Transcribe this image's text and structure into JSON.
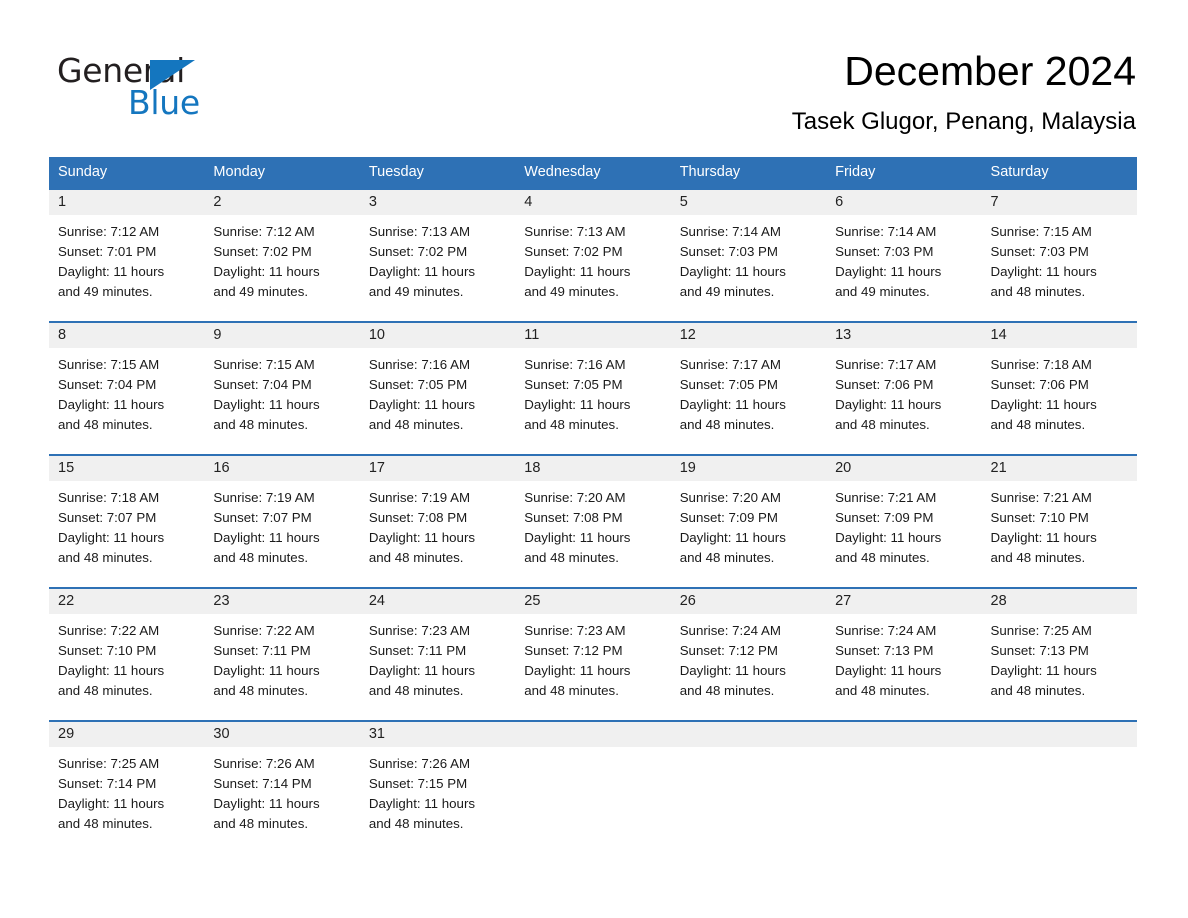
{
  "brand": {
    "name_top": "General",
    "name_bottom": "Blue",
    "triangle_color": "#1476bf",
    "text_color": "#231f20"
  },
  "header": {
    "title": "December 2024",
    "subtitle": "Tasek Glugor, Penang, Malaysia"
  },
  "theme": {
    "header_blue": "#2e71b5",
    "daynum_band": "#f0f0f0",
    "page_background": "#ffffff",
    "text": "#1a1a1a"
  },
  "weekdays": [
    "Sunday",
    "Monday",
    "Tuesday",
    "Wednesday",
    "Thursday",
    "Friday",
    "Saturday"
  ],
  "labels": {
    "sunrise_prefix": "Sunrise:",
    "sunset_prefix": "Sunset:",
    "daylight_prefix": "Daylight:"
  },
  "weeks": [
    [
      {
        "day": "1",
        "sunrise": "Sunrise: 7:12 AM",
        "sunset": "Sunset: 7:01 PM",
        "daylight1": "Daylight: 11 hours",
        "daylight2": "and 49 minutes."
      },
      {
        "day": "2",
        "sunrise": "Sunrise: 7:12 AM",
        "sunset": "Sunset: 7:02 PM",
        "daylight1": "Daylight: 11 hours",
        "daylight2": "and 49 minutes."
      },
      {
        "day": "3",
        "sunrise": "Sunrise: 7:13 AM",
        "sunset": "Sunset: 7:02 PM",
        "daylight1": "Daylight: 11 hours",
        "daylight2": "and 49 minutes."
      },
      {
        "day": "4",
        "sunrise": "Sunrise: 7:13 AM",
        "sunset": "Sunset: 7:02 PM",
        "daylight1": "Daylight: 11 hours",
        "daylight2": "and 49 minutes."
      },
      {
        "day": "5",
        "sunrise": "Sunrise: 7:14 AM",
        "sunset": "Sunset: 7:03 PM",
        "daylight1": "Daylight: 11 hours",
        "daylight2": "and 49 minutes."
      },
      {
        "day": "6",
        "sunrise": "Sunrise: 7:14 AM",
        "sunset": "Sunset: 7:03 PM",
        "daylight1": "Daylight: 11 hours",
        "daylight2": "and 49 minutes."
      },
      {
        "day": "7",
        "sunrise": "Sunrise: 7:15 AM",
        "sunset": "Sunset: 7:03 PM",
        "daylight1": "Daylight: 11 hours",
        "daylight2": "and 48 minutes."
      }
    ],
    [
      {
        "day": "8",
        "sunrise": "Sunrise: 7:15 AM",
        "sunset": "Sunset: 7:04 PM",
        "daylight1": "Daylight: 11 hours",
        "daylight2": "and 48 minutes."
      },
      {
        "day": "9",
        "sunrise": "Sunrise: 7:15 AM",
        "sunset": "Sunset: 7:04 PM",
        "daylight1": "Daylight: 11 hours",
        "daylight2": "and 48 minutes."
      },
      {
        "day": "10",
        "sunrise": "Sunrise: 7:16 AM",
        "sunset": "Sunset: 7:05 PM",
        "daylight1": "Daylight: 11 hours",
        "daylight2": "and 48 minutes."
      },
      {
        "day": "11",
        "sunrise": "Sunrise: 7:16 AM",
        "sunset": "Sunset: 7:05 PM",
        "daylight1": "Daylight: 11 hours",
        "daylight2": "and 48 minutes."
      },
      {
        "day": "12",
        "sunrise": "Sunrise: 7:17 AM",
        "sunset": "Sunset: 7:05 PM",
        "daylight1": "Daylight: 11 hours",
        "daylight2": "and 48 minutes."
      },
      {
        "day": "13",
        "sunrise": "Sunrise: 7:17 AM",
        "sunset": "Sunset: 7:06 PM",
        "daylight1": "Daylight: 11 hours",
        "daylight2": "and 48 minutes."
      },
      {
        "day": "14",
        "sunrise": "Sunrise: 7:18 AM",
        "sunset": "Sunset: 7:06 PM",
        "daylight1": "Daylight: 11 hours",
        "daylight2": "and 48 minutes."
      }
    ],
    [
      {
        "day": "15",
        "sunrise": "Sunrise: 7:18 AM",
        "sunset": "Sunset: 7:07 PM",
        "daylight1": "Daylight: 11 hours",
        "daylight2": "and 48 minutes."
      },
      {
        "day": "16",
        "sunrise": "Sunrise: 7:19 AM",
        "sunset": "Sunset: 7:07 PM",
        "daylight1": "Daylight: 11 hours",
        "daylight2": "and 48 minutes."
      },
      {
        "day": "17",
        "sunrise": "Sunrise: 7:19 AM",
        "sunset": "Sunset: 7:08 PM",
        "daylight1": "Daylight: 11 hours",
        "daylight2": "and 48 minutes."
      },
      {
        "day": "18",
        "sunrise": "Sunrise: 7:20 AM",
        "sunset": "Sunset: 7:08 PM",
        "daylight1": "Daylight: 11 hours",
        "daylight2": "and 48 minutes."
      },
      {
        "day": "19",
        "sunrise": "Sunrise: 7:20 AM",
        "sunset": "Sunset: 7:09 PM",
        "daylight1": "Daylight: 11 hours",
        "daylight2": "and 48 minutes."
      },
      {
        "day": "20",
        "sunrise": "Sunrise: 7:21 AM",
        "sunset": "Sunset: 7:09 PM",
        "daylight1": "Daylight: 11 hours",
        "daylight2": "and 48 minutes."
      },
      {
        "day": "21",
        "sunrise": "Sunrise: 7:21 AM",
        "sunset": "Sunset: 7:10 PM",
        "daylight1": "Daylight: 11 hours",
        "daylight2": "and 48 minutes."
      }
    ],
    [
      {
        "day": "22",
        "sunrise": "Sunrise: 7:22 AM",
        "sunset": "Sunset: 7:10 PM",
        "daylight1": "Daylight: 11 hours",
        "daylight2": "and 48 minutes."
      },
      {
        "day": "23",
        "sunrise": "Sunrise: 7:22 AM",
        "sunset": "Sunset: 7:11 PM",
        "daylight1": "Daylight: 11 hours",
        "daylight2": "and 48 minutes."
      },
      {
        "day": "24",
        "sunrise": "Sunrise: 7:23 AM",
        "sunset": "Sunset: 7:11 PM",
        "daylight1": "Daylight: 11 hours",
        "daylight2": "and 48 minutes."
      },
      {
        "day": "25",
        "sunrise": "Sunrise: 7:23 AM",
        "sunset": "Sunset: 7:12 PM",
        "daylight1": "Daylight: 11 hours",
        "daylight2": "and 48 minutes."
      },
      {
        "day": "26",
        "sunrise": "Sunrise: 7:24 AM",
        "sunset": "Sunset: 7:12 PM",
        "daylight1": "Daylight: 11 hours",
        "daylight2": "and 48 minutes."
      },
      {
        "day": "27",
        "sunrise": "Sunrise: 7:24 AM",
        "sunset": "Sunset: 7:13 PM",
        "daylight1": "Daylight: 11 hours",
        "daylight2": "and 48 minutes."
      },
      {
        "day": "28",
        "sunrise": "Sunrise: 7:25 AM",
        "sunset": "Sunset: 7:13 PM",
        "daylight1": "Daylight: 11 hours",
        "daylight2": "and 48 minutes."
      }
    ],
    [
      {
        "day": "29",
        "sunrise": "Sunrise: 7:25 AM",
        "sunset": "Sunset: 7:14 PM",
        "daylight1": "Daylight: 11 hours",
        "daylight2": "and 48 minutes."
      },
      {
        "day": "30",
        "sunrise": "Sunrise: 7:26 AM",
        "sunset": "Sunset: 7:14 PM",
        "daylight1": "Daylight: 11 hours",
        "daylight2": "and 48 minutes."
      },
      {
        "day": "31",
        "sunrise": "Sunrise: 7:26 AM",
        "sunset": "Sunset: 7:15 PM",
        "daylight1": "Daylight: 11 hours",
        "daylight2": "and 48 minutes."
      },
      {
        "day": "",
        "sunrise": "",
        "sunset": "",
        "daylight1": "",
        "daylight2": ""
      },
      {
        "day": "",
        "sunrise": "",
        "sunset": "",
        "daylight1": "",
        "daylight2": ""
      },
      {
        "day": "",
        "sunrise": "",
        "sunset": "",
        "daylight1": "",
        "daylight2": ""
      },
      {
        "day": "",
        "sunrise": "",
        "sunset": "",
        "daylight1": "",
        "daylight2": ""
      }
    ]
  ]
}
